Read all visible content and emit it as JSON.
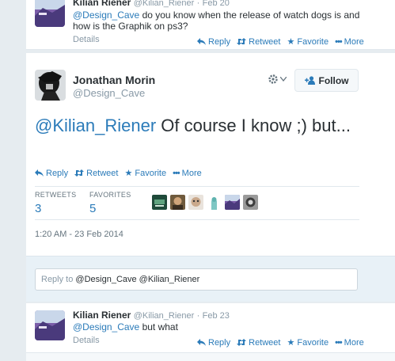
{
  "top_tweet": {
    "name": "Kilian Riener",
    "handle": "@Kilian_Riener",
    "dot": "·",
    "date": "Feb 20",
    "mention": "@Design_Cave",
    "text": " do you know when the  release of watch dogs is and how is the Graphik on ps3?",
    "details": "Details",
    "actions": {
      "reply": "Reply",
      "retweet": "Retweet",
      "favorite": "Favorite",
      "more": "More"
    }
  },
  "main_tweet": {
    "name": "Jonathan Morin",
    "handle": "@Design_Cave",
    "follow_label": "Follow",
    "mention": "@Kilian_Riener",
    "text": " Of course I know ;) but...",
    "actions": {
      "reply": "Reply",
      "retweet": "Retweet",
      "favorite": "Favorite",
      "more": "More"
    },
    "stats": {
      "retweets_label": "RETWEETS",
      "retweets_value": "3",
      "favorites_label": "FAVORITES",
      "favorites_value": "5"
    },
    "timestamp": "1:20 AM - 23 Feb 2014"
  },
  "reply_box": {
    "prefix": "Reply to ",
    "mentions": "@Design_Cave @Kilian_Riener"
  },
  "bottom_tweet": {
    "name": "Kilian Riener",
    "handle": "@Kilian_Riener",
    "dot": "·",
    "date": "Feb 23",
    "mention": "@Design_Cave",
    "text": " but what",
    "details": "Details",
    "actions": {
      "reply": "Reply",
      "retweet": "Retweet",
      "favorite": "Favorite",
      "more": "More"
    }
  },
  "colors": {
    "link": "#2b7bb9",
    "muted": "#8899a6",
    "text": "#292f33"
  }
}
